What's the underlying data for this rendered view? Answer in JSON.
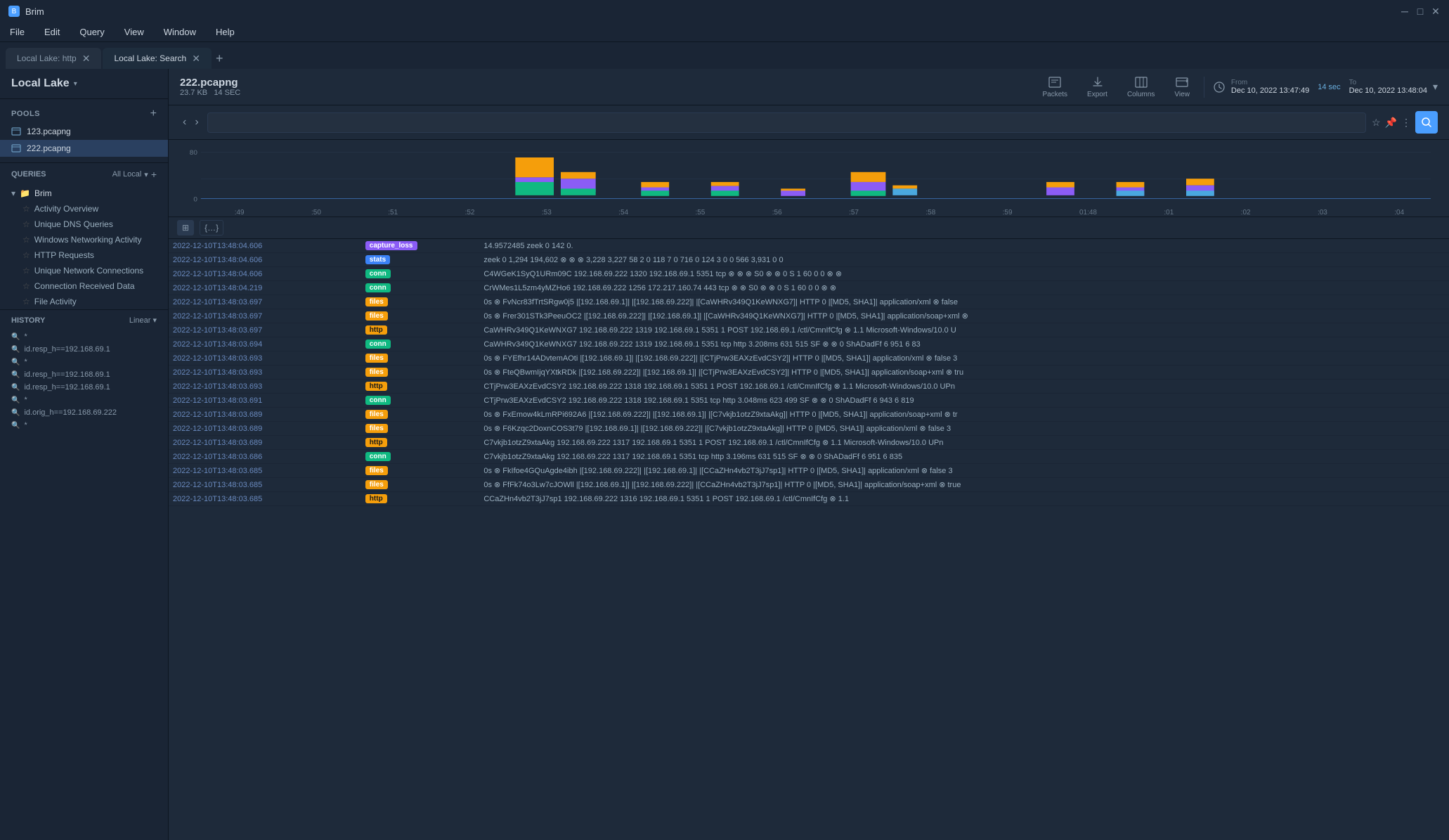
{
  "app": {
    "name": "Brim"
  },
  "titlebar": {
    "title": "Brim",
    "controls": [
      "minimize",
      "maximize",
      "close"
    ]
  },
  "menubar": {
    "items": [
      "File",
      "Edit",
      "Query",
      "View",
      "Window",
      "Help"
    ]
  },
  "tabs": [
    {
      "label": "Local Lake: http",
      "active": false,
      "closable": true
    },
    {
      "label": "Local Lake: Search",
      "active": true,
      "closable": true
    }
  ],
  "sidebar": {
    "title": "Local Lake",
    "pools_label": "POOLS",
    "pools": [
      {
        "name": "123.pcapng",
        "active": false
      },
      {
        "name": "222.pcapng",
        "active": true
      }
    ],
    "queries_label": "QUERIES",
    "queries_filter": "All Local",
    "folder": "Brim",
    "query_items": [
      "Activity Overview",
      "Unique DNS Queries",
      "Windows Networking Activity",
      "HTTP Requests",
      "Unique Network Connections",
      "Connection Received Data",
      "File Activity"
    ],
    "history_label": "HISTORY",
    "history_mode": "Linear",
    "history_items": [
      "*",
      "id.resp_h==192.168.69.1",
      "*",
      "id.resp_h==192.168.69.1",
      "id.resp_h==192.168.69.1",
      "*",
      "id.orig_h==192.168.69.222",
      "*"
    ]
  },
  "pool": {
    "name": "222.pcapng",
    "size": "23.7 KB",
    "duration": "14 SEC"
  },
  "toolbar_buttons": [
    {
      "icon": "📄",
      "label": "Packets"
    },
    {
      "icon": "📤",
      "label": "Export"
    },
    {
      "icon": "⊞",
      "label": "Columns"
    },
    {
      "icon": "⊟",
      "label": "View"
    }
  ],
  "time_range": {
    "from_label": "From",
    "from": "Dec 10, 2022  13:47:49",
    "duration": "14 sec",
    "to_label": "To",
    "to": "Dec 10, 2022  13:48:04"
  },
  "chart": {
    "y_max": 80,
    "y_min": 0,
    "x_labels": [
      ":49",
      ":50",
      ":51",
      ":52",
      ":53",
      ":54",
      ":55",
      ":56",
      ":57",
      ":58",
      ":59",
      "01:48",
      ":01",
      ":02",
      ":03",
      ":04"
    ]
  },
  "table_rows": [
    {
      "time": "2022-12-10T13:48:04.606",
      "badge": "capture_loss",
      "badge_class": "badge-capture",
      "data": "14.9572485  zeek  0  142  0."
    },
    {
      "time": "2022-12-10T13:48:04.606",
      "badge": "stats",
      "badge_class": "badge-stats",
      "data": "zeek  0  1,294  194,602  ⊗  ⊗  ⊗  3,228  3,227  58  2  0  118  7  0  716  0  124  3  0  0  566  3,931  0  0"
    },
    {
      "time": "2022-12-10T13:48:04.606",
      "badge": "conn",
      "badge_class": "badge-conn",
      "data": "C4WGeK1SyQ1URm09C  192.168.69.222  1320  192.168.69.1  5351  tcp  ⊗  ⊗  ⊗  S0  ⊗  ⊗  0  S  1  60  0  0  ⊗  ⊗"
    },
    {
      "time": "2022-12-10T13:48:04.219",
      "badge": "conn",
      "badge_class": "badge-conn",
      "data": "CrWMes1L5zm4yMZHo6  192.168.69.222  1256  172.217.160.74  443  tcp  ⊗  ⊗  S0  ⊗  ⊗  0  S  1  60  0  0  ⊗  ⊗"
    },
    {
      "time": "2022-12-10T13:48:03.697",
      "badge": "files",
      "badge_class": "badge-files",
      "data": "0s  ⊗  FvNcr83fTrtSRgw0j5  |[192.168.69.1]|  |[192.168.69.222]|  |[CaWHRv349Q1KeWNXG7]|  HTTP  0  |[MD5, SHA1]|  application/xml  ⊗  false"
    },
    {
      "time": "2022-12-10T13:48:03.697",
      "badge": "files",
      "badge_class": "badge-files",
      "data": "0s  ⊗  Frer301STk3PeeuOC2  |[192.168.69.222]|  |[192.168.69.1]|  |[CaWHRv349Q1KeWNXG7]|  HTTP  0  |[MD5, SHA1]|  application/soap+xml  ⊗"
    },
    {
      "time": "2022-12-10T13:48:03.697",
      "badge": "http",
      "badge_class": "badge-http",
      "data": "CaWHRv349Q1KeWNXG7  192.168.69.222  1319  192.168.69.1  5351  1  POST  192.168.69.1  /ctl/CmnIfCfg  ⊗  1.1  Microsoft-Windows/10.0 U"
    },
    {
      "time": "2022-12-10T13:48:03.694",
      "badge": "conn",
      "badge_class": "badge-conn",
      "data": "CaWHRv349Q1KeWNXG7  192.168.69.222  1319  192.168.69.1  5351  tcp  http  3.208ms  631  515  SF  ⊗  ⊗  0  ShADadFf  6  951  6  83"
    },
    {
      "time": "2022-12-10T13:48:03.693",
      "badge": "files",
      "badge_class": "badge-files",
      "data": "0s  ⊗  FYEfhr14ADvtemAOti  |[192.168.69.1]|  |[192.168.69.222]|  |[CTjPrw3EAXzEvdCSY2]|  HTTP  0  |[MD5, SHA1]|  application/xml  ⊗  false  3"
    },
    {
      "time": "2022-12-10T13:48:03.693",
      "badge": "files",
      "badge_class": "badge-files",
      "data": "0s  ⊗  FteQBwmIjqYXtkRDk  |[192.168.69.222]|  |[192.168.69.1]|  |[CTjPrw3EAXzEvdCSY2]|  HTTP  0  |[MD5, SHA1]|  application/soap+xml  ⊗  tru"
    },
    {
      "time": "2022-12-10T13:48:03.693",
      "badge": "http",
      "badge_class": "badge-http",
      "data": "CTjPrw3EAXzEvdCSY2  192.168.69.222  1318  192.168.69.1  5351  1  POST  192.168.69.1  /ctl/CmnIfCfg  ⊗  1.1  Microsoft-Windows/10.0 UPn"
    },
    {
      "time": "2022-12-10T13:48:03.691",
      "badge": "conn",
      "badge_class": "badge-conn",
      "data": "CTjPrw3EAXzEvdCSY2  192.168.69.222  1318  192.168.69.1  5351  tcp  http  3.048ms  623  499  SF  ⊗  ⊗  0  ShADadFf  6  943  6  819"
    },
    {
      "time": "2022-12-10T13:48:03.689",
      "badge": "files",
      "badge_class": "badge-files",
      "data": "0s  ⊗  FxEmow4kLmRPi692A6  |[192.168.69.222]|  |[192.168.69.1]|  |[C7vkjb1otzZ9xtaAkg]|  HTTP  0  |[MD5, SHA1]|  application/soap+xml  ⊗  tr"
    },
    {
      "time": "2022-12-10T13:48:03.689",
      "badge": "files",
      "badge_class": "badge-files",
      "data": "0s  ⊗  F6Kzqc2DoxnCOS3t79  |[192.168.69.1]|  |[192.168.69.222]|  |[C7vkjb1otzZ9xtaAkg]|  HTTP  0  |[MD5, SHA1]|  application/xml  ⊗  false  3"
    },
    {
      "time": "2022-12-10T13:48:03.689",
      "badge": "http",
      "badge_class": "badge-http",
      "data": "C7vkjb1otzZ9xtaAkg  192.168.69.222  1317  192.168.69.1  5351  1  POST  192.168.69.1  /ctl/CmnIfCfg  ⊗  1.1  Microsoft-Windows/10.0 UPn"
    },
    {
      "time": "2022-12-10T13:48:03.686",
      "badge": "conn",
      "badge_class": "badge-conn",
      "data": "C7vkjb1otzZ9xtaAkg  192.168.69.222  1317  192.168.69.1  5351  tcp  http  3.196ms  631  515  SF  ⊗  ⊗  0  ShADadFf  6  951  6  835"
    },
    {
      "time": "2022-12-10T13:48:03.685",
      "badge": "files",
      "badge_class": "badge-files",
      "data": "0s  ⊗  FkIfoe4GQuAgde4ibh  |[192.168.69.222]|  |[192.168.69.1]|  |[CCaZHn4vb2T3jJ7sp1]|  HTTP  0  |[MD5, SHA1]|  application/xml  ⊗  false  3"
    },
    {
      "time": "2022-12-10T13:48:03.685",
      "badge": "files",
      "badge_class": "badge-files",
      "data": "0s  ⊗  FfFk74o3Lw7cJOWll  |[192.168.69.1]|  |[192.168.69.222]|  |[CCaZHn4vb2T3jJ7sp1]|  HTTP  0  |[MD5, SHA1]|  application/soap+xml  ⊗  true"
    },
    {
      "time": "2022-12-10T13:48:03.685",
      "badge": "http",
      "badge_class": "badge-http",
      "data": "CCaZHn4vb2T3jJ7sp1  192.168.69.222  1316  192.168.69.1  5351  1  POST  192.168.69.1  /ctl/CmnIfCfg  ⊗  1.1"
    }
  ]
}
